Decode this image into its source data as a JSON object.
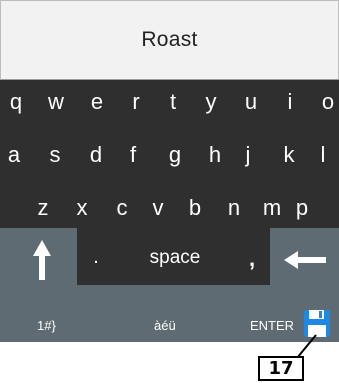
{
  "input": {
    "value": "Roast"
  },
  "keyboard": {
    "row1": [
      "q",
      "w",
      "e",
      "r",
      "t",
      "y",
      "u",
      "i",
      "o"
    ],
    "row2": [
      "a",
      "s",
      "d",
      "f",
      "g",
      "h",
      "j",
      "k",
      "l"
    ],
    "row3": [
      "z",
      "x",
      "c",
      "v",
      "b",
      "n",
      "m",
      "p"
    ],
    "period": ".",
    "space": "space",
    "comma": ",",
    "symbols": "1#}",
    "accents": "àéü",
    "enter": "ENTER"
  },
  "callout": {
    "number": "17"
  },
  "colors": {
    "keyboard_bg": "#2f2f2f",
    "function_bar": "#5f6b72",
    "save_icon": "#1e88e5"
  },
  "icons": [
    "shift-arrow-up-icon",
    "backspace-arrow-left-icon",
    "save-floppy-icon"
  ]
}
